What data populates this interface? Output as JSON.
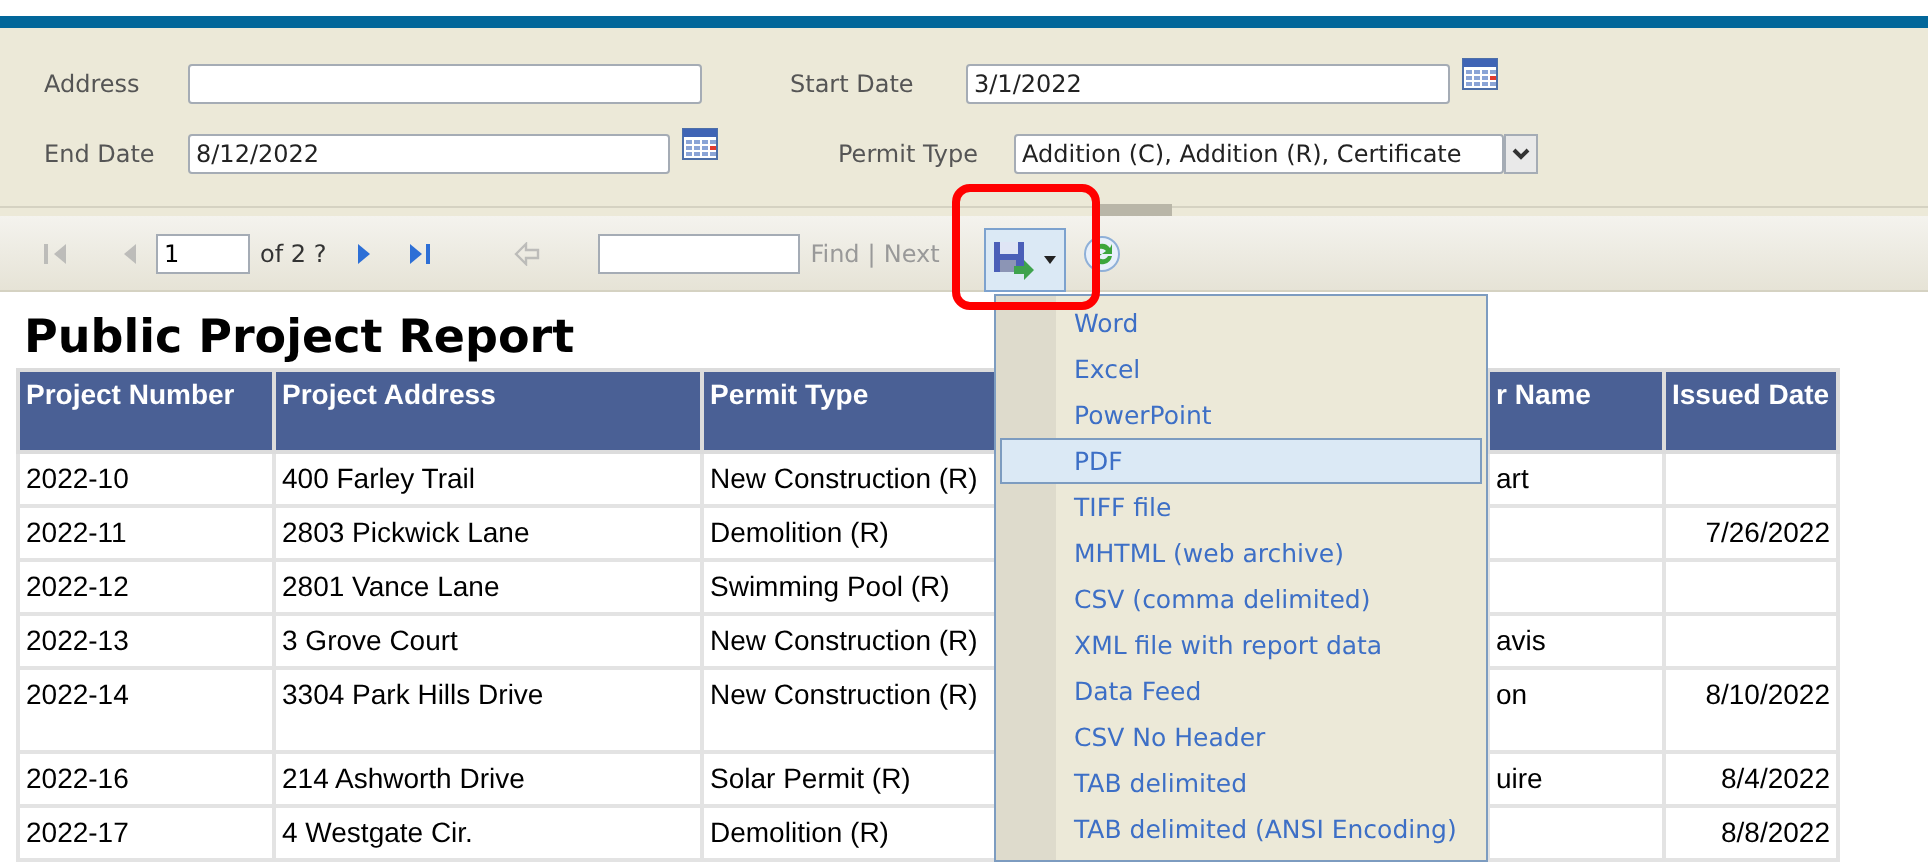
{
  "parameters": [
    {
      "label": "Address",
      "kind": "text"
    },
    {
      "label": "Start Date",
      "value": "3/1/2022",
      "kind": "date"
    },
    {
      "label": "End Date",
      "value": "8/12/2022",
      "kind": "date"
    },
    {
      "label": "Permit Type",
      "value": "Addition (C), Addition (R), Certificate",
      "kind": "multiselect"
    }
  ],
  "toolbar": {
    "nav": [
      {
        "kind": "first",
        "disabled": true
      },
      {
        "kind": "prev",
        "disabled": true
      },
      {
        "kind": "page",
        "value": "1"
      },
      {
        "kind": "count",
        "text": "of 2 ?"
      },
      {
        "kind": "next",
        "disabled": false
      },
      {
        "kind": "last",
        "disabled": false
      },
      {
        "kind": "back",
        "disabled": true
      }
    ],
    "find_link": "Find",
    "separator": "|",
    "next_link": "Next",
    "export_open": true
  },
  "export_menu": [
    {
      "label": "Word",
      "selected": false
    },
    {
      "label": "Excel",
      "selected": false
    },
    {
      "label": "PowerPoint",
      "selected": false
    },
    {
      "label": "PDF",
      "selected": true
    },
    {
      "label": "TIFF file",
      "selected": false
    },
    {
      "label": "MHTML (web archive)",
      "selected": false
    },
    {
      "label": "CSV (comma delimited)",
      "selected": false
    },
    {
      "label": "XML file with report data",
      "selected": false
    },
    {
      "label": "Data Feed",
      "selected": false
    },
    {
      "label": "CSV No Header",
      "selected": false
    },
    {
      "label": "TAB delimited",
      "selected": false
    },
    {
      "label": "TAB delimited (ANSI Encoding)",
      "selected": false
    }
  ],
  "report": {
    "title": "Public Project Report",
    "columns": [
      "Project Number",
      "Project Address",
      "Permit Type",
      "r Name",
      "Issued Date"
    ],
    "rows": [
      {
        "project_number": "2022-10",
        "project_address": "400 Farley Trail",
        "permit_type": "New Construction (R)",
        "column_4": "art",
        "tall": false
      },
      {
        "project_number": "2022-11",
        "project_address": "2803 Pickwick Lane",
        "permit_type": "Demolition (R)",
        "issued_date": "7/26/2022",
        "tall": false
      },
      {
        "project_number": "2022-12",
        "project_address": "2801 Vance Lane",
        "permit_type": "Swimming Pool (R)",
        "tall": false
      },
      {
        "project_number": "2022-13",
        "project_address": "3 Grove Court",
        "permit_type": "New Construction (R)",
        "column_4": "avis",
        "tall": false
      },
      {
        "project_number": "2022-14",
        "project_address": "3304 Park Hills Drive",
        "permit_type": "New Construction (R)",
        "column_4": "on",
        "issued_date": "8/10/2022",
        "tall": true
      },
      {
        "project_number": "2022-16",
        "project_address": "214 Ashworth Drive",
        "permit_type": "Solar Permit (R)",
        "column_4": "uire",
        "issued_date": "8/4/2022",
        "tall": false
      },
      {
        "project_number": "2022-17",
        "project_address": "4 Westgate Cir.",
        "permit_type": "Demolition (R)",
        "issued_date": "8/8/2022",
        "tall": false
      }
    ]
  },
  "highlight_frame": true
}
